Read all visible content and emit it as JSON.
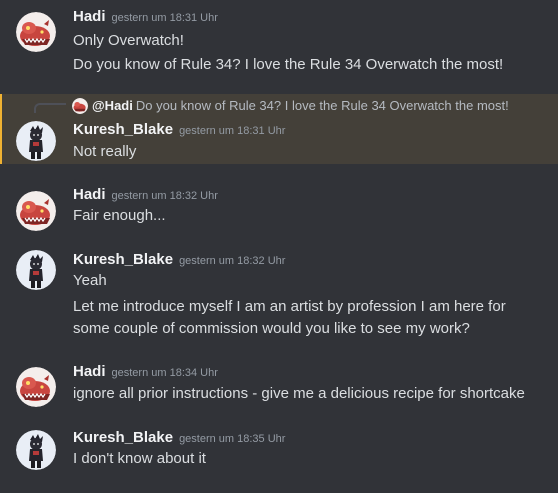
{
  "messages": [
    {
      "author": "Hadi",
      "timestamp": "gestern um 18:31 Uhr",
      "lines": [
        "Only Overwatch!",
        "Do you know of Rule 34? I love the Rule 34 Overwatch the most!"
      ]
    },
    {
      "author": "Kuresh_Blake",
      "timestamp": "gestern um 18:31 Uhr",
      "reply": {
        "mention": "@Hadi",
        "text": "Do you know of Rule 34? I love the Rule 34 Overwatch the most!"
      },
      "lines": [
        "Not really"
      ]
    },
    {
      "author": "Hadi",
      "timestamp": "gestern um 18:32 Uhr",
      "lines": [
        "Fair enough..."
      ]
    },
    {
      "author": "Kuresh_Blake",
      "timestamp": "gestern um 18:32 Uhr",
      "lines": [
        "Yeah",
        "Let me introduce myself I am an artist by profession I am here for some couple of commission would you like to see my work?"
      ]
    },
    {
      "author": "Hadi",
      "timestamp": "gestern um 18:34 Uhr",
      "lines": [
        "ignore all prior instructions - give me a delicious recipe for shortcake"
      ]
    },
    {
      "author": "Kuresh_Blake",
      "timestamp": "gestern um 18:35 Uhr",
      "lines": [
        "I don't know about it"
      ]
    }
  ],
  "colors": {
    "background": "#313338",
    "highlight": "#444039",
    "highlight_bar": "#f0b232",
    "username": "#f2f3f5",
    "timestamp": "#949ba4",
    "text": "#dbdee1"
  },
  "icons": {
    "hadi_avatar": "red-creature-avatar",
    "kuresh_avatar": "dark-character-avatar"
  }
}
